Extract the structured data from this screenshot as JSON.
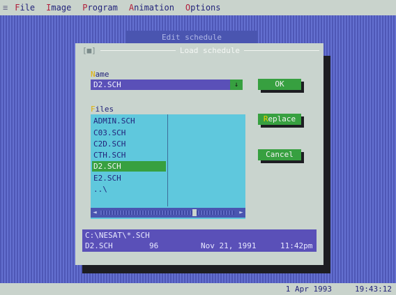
{
  "menubar": {
    "system_glyph": "≡",
    "items": [
      {
        "hotkey": "F",
        "rest": "ile"
      },
      {
        "hotkey": "I",
        "rest": "mage"
      },
      {
        "hotkey": "P",
        "rest": "rogram"
      },
      {
        "hotkey": "A",
        "rest": "nimation"
      },
      {
        "hotkey": "O",
        "rest": "ptions"
      }
    ]
  },
  "background_dialog": {
    "title": "Edit schedule"
  },
  "dialog": {
    "close_glyph": "[■]",
    "title": "Load schedule",
    "name_label": {
      "hotkey": "N",
      "rest": "ame"
    },
    "name_value": "D2.SCH",
    "history_glyph": "↓",
    "files_label": {
      "hotkey": "F",
      "rest": "iles"
    },
    "files": [
      "ADMIN.SCH",
      "C03.SCH",
      "C2D.SCH",
      "CTH.SCH",
      "D2.SCH",
      "E2.SCH",
      "..\\"
    ],
    "selected_file": "D2.SCH",
    "scroll_left": "◄",
    "scroll_right": "►",
    "buttons": {
      "ok": {
        "label": "OK"
      },
      "replace": {
        "hotkey": "R",
        "rest": "eplace"
      },
      "cancel": {
        "label": "Cancel"
      }
    },
    "info": {
      "path": "C:\\NESAT\\*.SCH",
      "name": "D2.SCH",
      "size": "96",
      "date": "Nov 21, 1991",
      "time": "11:42pm"
    }
  },
  "statusbar": {
    "date": "1 Apr 1993",
    "time": "19:43:12"
  },
  "colors": {
    "desktop": "#5a64c2",
    "menubar": "#c9d3cc",
    "dialog": "#c9d4ce",
    "button": "#37a040",
    "input": "#5a50b8",
    "listbox": "#5fc8dd",
    "hotkey": "#b01e3a"
  }
}
